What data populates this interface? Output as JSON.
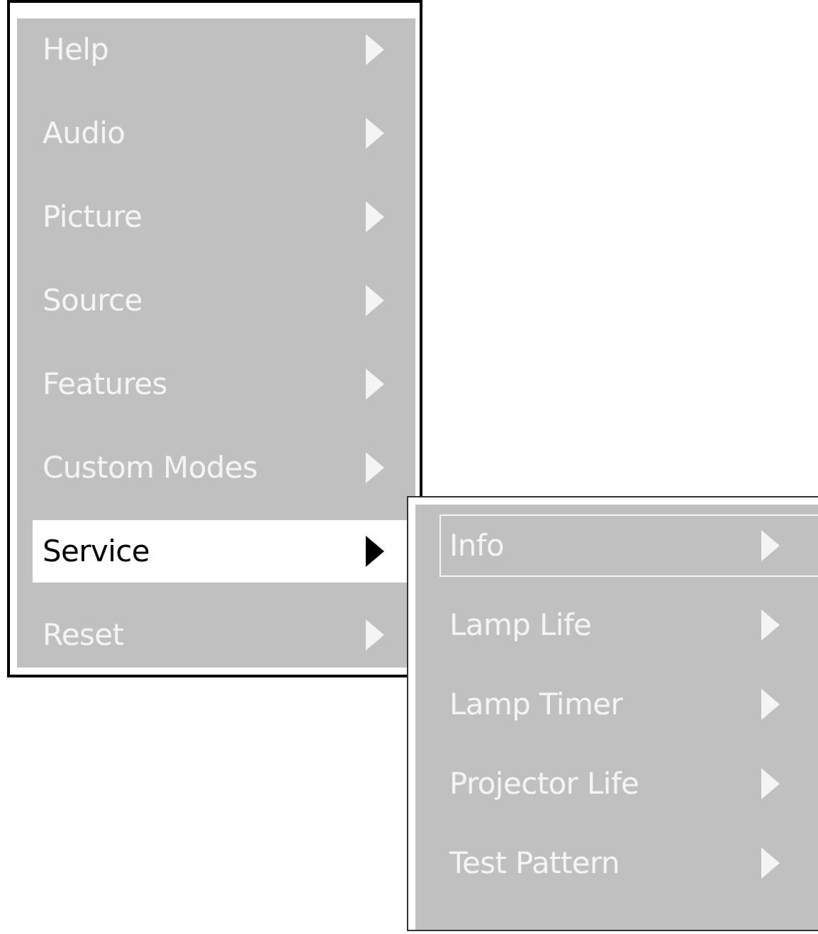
{
  "menu": {
    "items": [
      {
        "label": "Help",
        "selected": false
      },
      {
        "label": "Audio",
        "selected": false
      },
      {
        "label": "Picture",
        "selected": false
      },
      {
        "label": "Source",
        "selected": false
      },
      {
        "label": "Features",
        "selected": false
      },
      {
        "label": "Custom Modes",
        "selected": false
      },
      {
        "label": "Service",
        "selected": true
      },
      {
        "label": "Reset",
        "selected": false
      }
    ]
  },
  "submenu": {
    "items": [
      {
        "label": "Info",
        "selected": true
      },
      {
        "label": "Lamp Life",
        "selected": false
      },
      {
        "label": "Lamp Timer",
        "selected": false
      },
      {
        "label": "Projector Life",
        "selected": false
      },
      {
        "label": "Test Pattern",
        "selected": false
      }
    ]
  }
}
